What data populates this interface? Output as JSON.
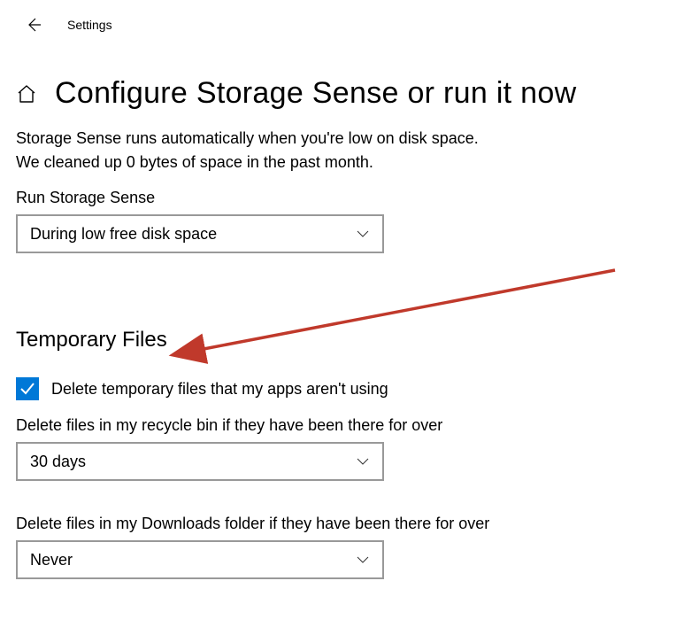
{
  "header": {
    "app_title": "Settings"
  },
  "page": {
    "title": "Configure Storage Sense or run it now",
    "description_line1": "Storage Sense runs automatically when you're low on disk space.",
    "description_line2": "We cleaned up 0 bytes of space in the past month."
  },
  "run_section": {
    "label": "Run Storage Sense",
    "dropdown_value": "During low free disk space"
  },
  "temp_section": {
    "title": "Temporary Files",
    "checkbox_label": "Delete temporary files that my apps aren't using",
    "checkbox_checked": true,
    "recycle_label": "Delete files in my recycle bin if they have been there for over",
    "recycle_dropdown_value": "30 days",
    "downloads_label": "Delete files in my Downloads folder if they have been there for over",
    "downloads_dropdown_value": "Never"
  },
  "annotation": {
    "color": "#c0392b"
  }
}
